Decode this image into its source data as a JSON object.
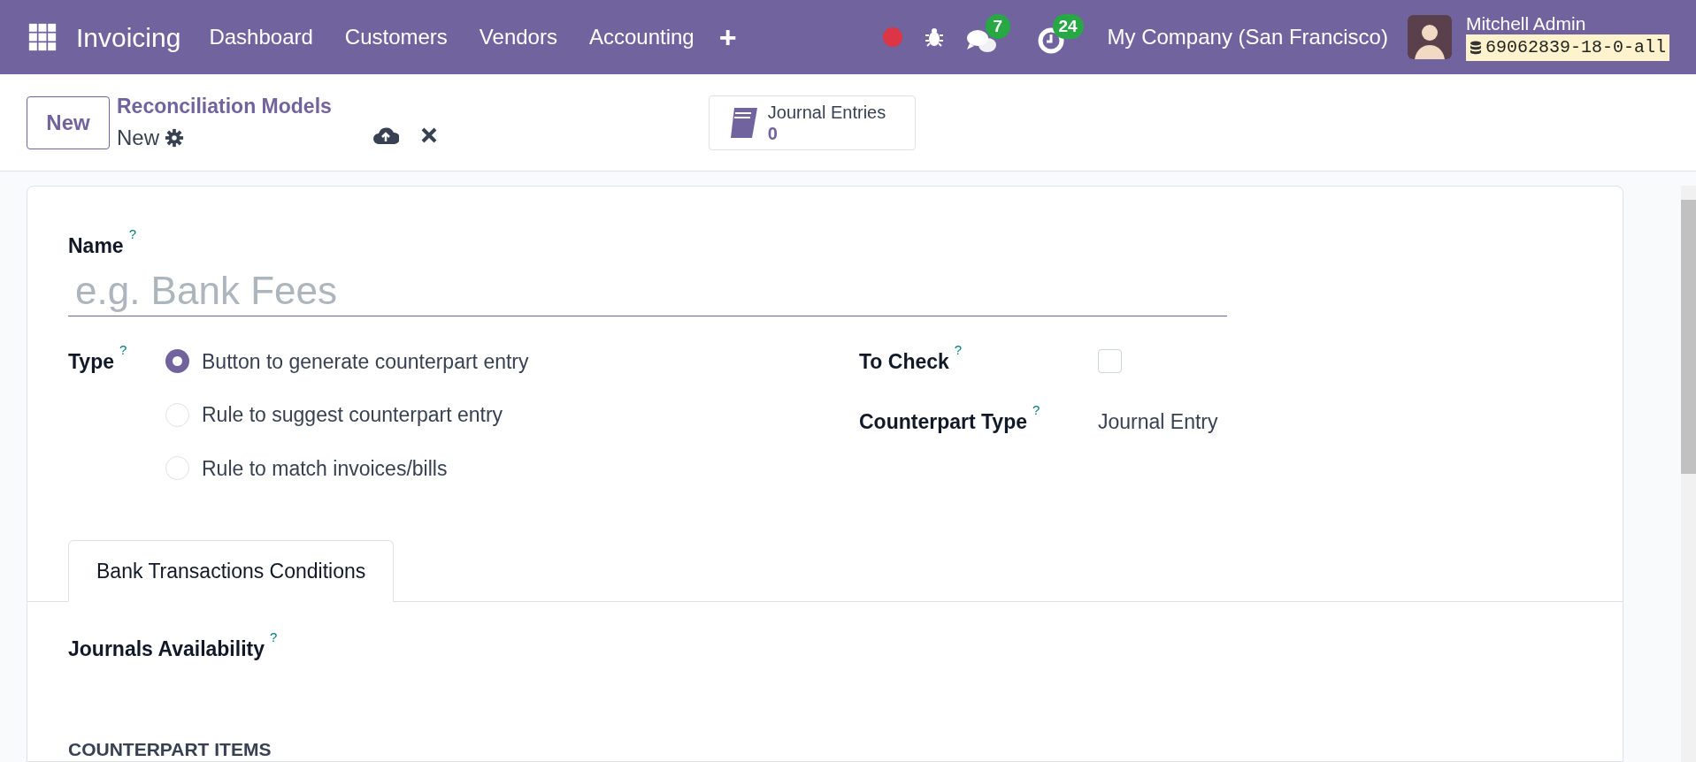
{
  "navbar": {
    "app_name": "Invoicing",
    "menu": [
      "Dashboard",
      "Customers",
      "Vendors",
      "Accounting"
    ],
    "add_symbol": "+",
    "messages_count": "7",
    "activities_count": "24",
    "company": "My Company (San Francisco)",
    "user_name": "Mitchell Admin",
    "database": "69062839-18-0-all"
  },
  "control_panel": {
    "new_button": "New",
    "breadcrumb": "Reconciliation Models",
    "record_title": "New",
    "smart_button": {
      "label": "Journal Entries",
      "value": "0"
    }
  },
  "form": {
    "name": {
      "label": "Name",
      "help": "?",
      "placeholder": "e.g. Bank Fees"
    },
    "type": {
      "label": "Type",
      "help": "?",
      "options": [
        {
          "label": "Button to generate counterpart entry",
          "selected": true
        },
        {
          "label": "Rule to suggest counterpart entry",
          "selected": false
        },
        {
          "label": "Rule to match invoices/bills",
          "selected": false
        }
      ]
    },
    "to_check": {
      "label": "To Check",
      "help": "?",
      "checked": false
    },
    "counterpart_type": {
      "label": "Counterpart Type",
      "help": "?",
      "value": "Journal Entry"
    },
    "tabs": [
      {
        "label": "Bank Transactions Conditions",
        "selected": true
      }
    ],
    "journals_availability": {
      "label": "Journals Availability",
      "help": "?"
    },
    "section_title": "COUNTERPART ITEMS"
  }
}
